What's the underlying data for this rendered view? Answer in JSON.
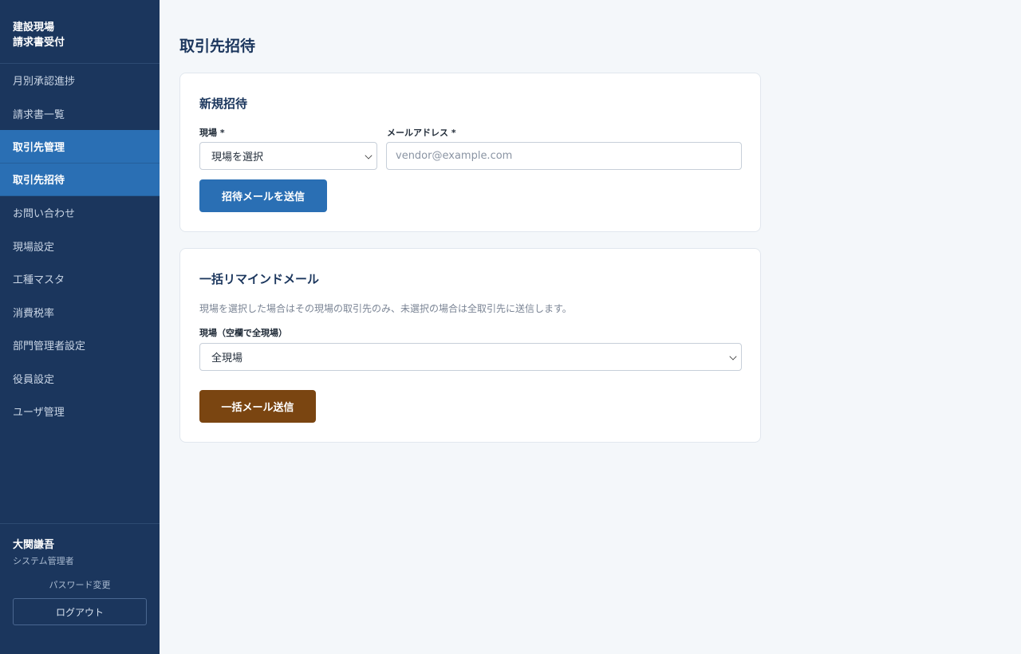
{
  "sidebar": {
    "brand_line1": "建設現場",
    "brand_line2": "請求書受付",
    "items": [
      {
        "label": "月別承認進捗",
        "active": false
      },
      {
        "label": "請求書一覧",
        "active": false
      },
      {
        "label": "取引先管理",
        "active": true
      },
      {
        "label": "取引先招待",
        "active": true
      },
      {
        "label": "お問い合わせ",
        "active": false
      },
      {
        "label": "現場設定",
        "active": false
      },
      {
        "label": "工種マスタ",
        "active": false
      },
      {
        "label": "消費税率",
        "active": false
      },
      {
        "label": "部門管理者設定",
        "active": false
      },
      {
        "label": "役員設定",
        "active": false
      },
      {
        "label": "ユーザ管理",
        "active": false
      }
    ],
    "user": {
      "name": "大関謙吾",
      "role": "システム管理者"
    },
    "password_link": "パスワード変更",
    "logout_label": "ログアウト"
  },
  "main": {
    "page_title": "取引先招待",
    "invite_card": {
      "title": "新規招待",
      "site_label": "現場 *",
      "site_value": "現場を選択",
      "email_label": "メールアドレス *",
      "email_value": "",
      "email_placeholder": "vendor@example.com",
      "submit_label": "招待メールを送信"
    },
    "remind_card": {
      "title": "一括リマインドメール",
      "hint": "現場を選択した場合はその現場の取引先のみ、未選択の場合は全取引先に送信します。",
      "site_label": "現場（空欄で全現場）",
      "site_value": "全現場",
      "submit_label": "一括メール送信"
    }
  },
  "colors": {
    "sidebar_bg": "#1b365d",
    "accent": "#2a6fb4",
    "bulk_button": "#7a4511",
    "page_bg": "#f4f7fa"
  }
}
